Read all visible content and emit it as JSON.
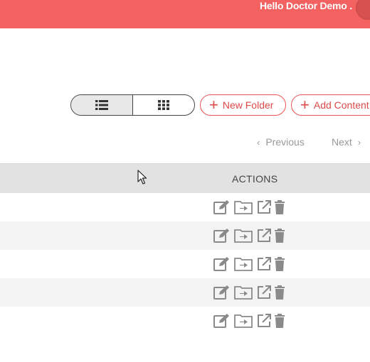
{
  "header": {
    "greeting": "Hello Doctor Demo ."
  },
  "toolbar": {
    "view_list_icon": "list-icon",
    "view_grid_icon": "grid-icon",
    "new_folder_label": "New Folder",
    "add_content_label": "Add Content",
    "plus": "+"
  },
  "pager": {
    "previous_label": "Previous",
    "next_label": "Next",
    "prev_chev": "‹",
    "next_chev": "›"
  },
  "table": {
    "actions_header": "ACTIONS",
    "row_actions": [
      "edit-icon",
      "move-to-folder-icon",
      "open-external-icon",
      "delete-icon"
    ],
    "row_count": 5
  },
  "colors": {
    "brand": "#f36161",
    "accent_text": "#e04848",
    "icon": "#8a8a8a"
  }
}
